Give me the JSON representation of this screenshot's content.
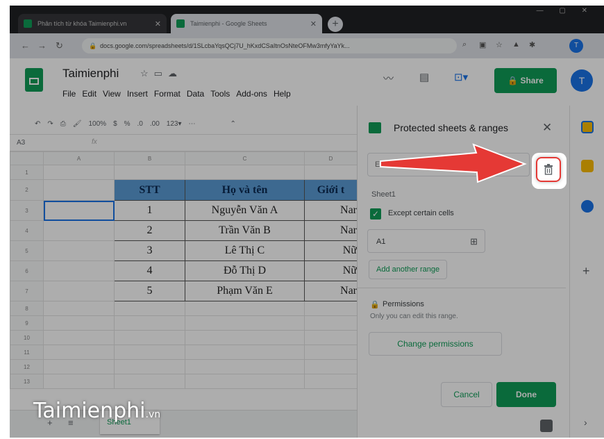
{
  "browser": {
    "tabs": [
      {
        "title": "Phân tích từ khóa Taimienphi.vn"
      },
      {
        "title": "Taimienphi - Google Sheets"
      }
    ],
    "url": "docs.google.com/spreadsheets/d/1SLcbaYqsQCj7U_hKxdCSaItnOsNteOFMw3mfyYaYk..."
  },
  "sheets": {
    "doc_title": "Taimienphi",
    "menu": [
      "File",
      "Edit",
      "View",
      "Insert",
      "Format",
      "Data",
      "Tools",
      "Add-ons",
      "Help"
    ],
    "zoom": "100%",
    "name_box": "A3",
    "share_label": "Share",
    "avatar_letter": "T",
    "columns": [
      "A",
      "B",
      "C",
      "D"
    ],
    "row_numbers": [
      "1",
      "2",
      "3",
      "4",
      "5",
      "6",
      "7",
      "8",
      "9",
      "10",
      "11",
      "12",
      "13"
    ],
    "table": {
      "headers": [
        "STT",
        "Họ và tên",
        "Giới t"
      ],
      "rows": [
        [
          "1",
          "Nguyễn Văn A",
          "Nar"
        ],
        [
          "2",
          "Trần Văn B",
          "Nar"
        ],
        [
          "3",
          "Lê Thị C",
          "Nữ"
        ],
        [
          "4",
          "Đỗ Thị D",
          "Nữ"
        ],
        [
          "5",
          "Phạm Văn E",
          "Nar"
        ]
      ]
    },
    "sheet_tab": "Sheet1"
  },
  "panel": {
    "title": "Protected sheets & ranges",
    "description_placeholder": "Enter a description",
    "sheet_name": "Sheet1",
    "except_label": "Except certain cells",
    "except_checked": true,
    "range_value": "A1",
    "add_range_label": "Add another range",
    "permissions_title": "Permissions",
    "permissions_desc": "Only you can edit this range.",
    "change_permissions_label": "Change permissions",
    "cancel_label": "Cancel",
    "done_label": "Done"
  },
  "annotation": {
    "arrow_color": "#e53935",
    "highlight": "delete-range-button"
  },
  "watermark": {
    "brand": "Taimienphi",
    "suffix": ".vn"
  },
  "colors": {
    "sheets_green": "#0f9d58",
    "header_blue": "#5b9bd5",
    "accent_blue": "#1a73e8"
  }
}
